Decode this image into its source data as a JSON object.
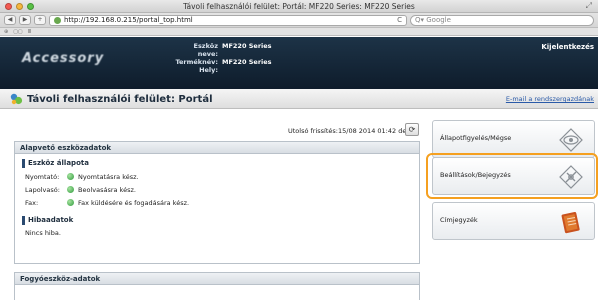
{
  "browser": {
    "window_title": "Távoli felhasználói felület: Portál: MF220 Series: MF220 Series",
    "url": "http://192.168.0.215/portal_top.html",
    "search_placeholder": "Google",
    "back": "◀",
    "forward": "▶",
    "add": "+",
    "reload": "C",
    "close": "⤢",
    "bookmarks": [
      "⊕",
      "▢▢",
      "Ⅲ"
    ]
  },
  "header": {
    "logo_text": "Accessory",
    "device_name_label": "Eszköz neve:",
    "device_name": "MF220 Series",
    "product_name_label": "Terméknév:",
    "product_name": "MF220 Series",
    "location_label": "Hely:",
    "location": "",
    "logout": "Kijelentkezés"
  },
  "page": {
    "title": "Távoli felhasználói felület: Portál",
    "mail_link": "E-mail a rendszergazdának"
  },
  "status": {
    "last_updated": "Utolsó frissítés:15/08 2014 01:42 de",
    "refresh": "⟳"
  },
  "basic_info": {
    "heading": "Alapvető eszközadatok",
    "device_status_title": "Eszköz állapota",
    "rows": [
      {
        "key": "Nyomtató:",
        "value": "Nyomtatásra kész."
      },
      {
        "key": "Lapolvasó:",
        "value": "Beolvasásra kész."
      },
      {
        "key": "Fax:",
        "value": "Fax küldésére és fogadására kész."
      }
    ],
    "error_title": "Hibaadatok",
    "error_text": "Nincs hiba."
  },
  "consumables": {
    "heading": "Fogyóeszköz-adatok"
  },
  "right_menu": {
    "status_monitor": "Állapotfigyelés/Mégse",
    "settings": "Beállítások/Bejegyzés",
    "address_book": "Címjegyzék"
  },
  "colors": {
    "highlight": "#f5a020",
    "header_bg": "#14263a",
    "status_ok": "#2f9a3c"
  }
}
